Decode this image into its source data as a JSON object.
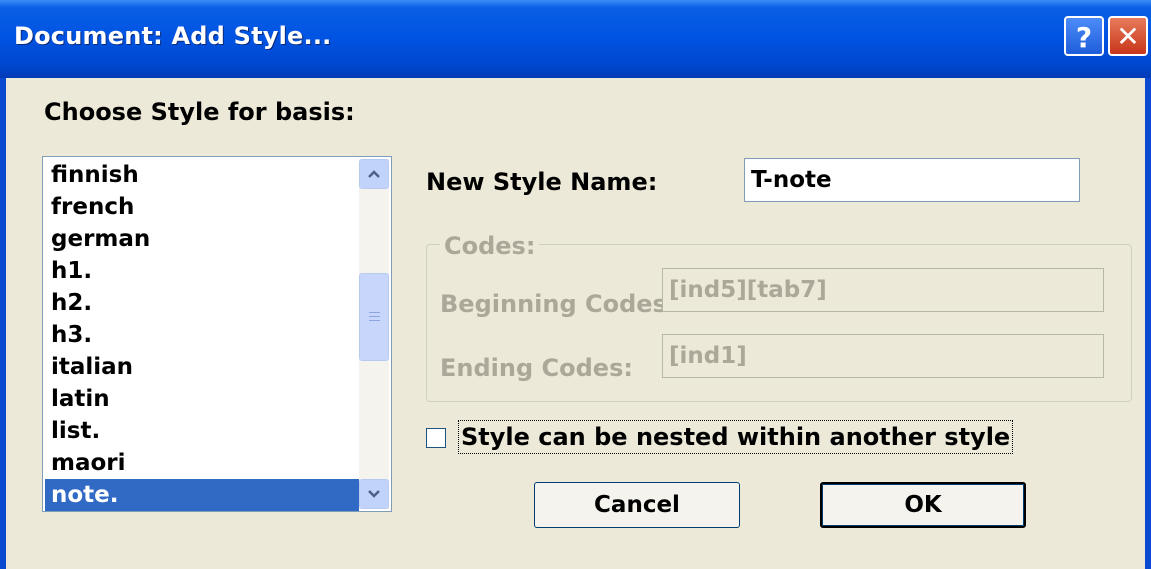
{
  "window": {
    "title": "Document: Add Style...",
    "help_label": "?",
    "close_label": "✕"
  },
  "basis": {
    "label": "Choose Style for basis:",
    "items": [
      "finnish",
      "french",
      "german",
      "h1.",
      "h2.",
      "h3.",
      "italian",
      "latin",
      "list.",
      "maori",
      "note."
    ],
    "selected": "note."
  },
  "name": {
    "label": "New Style Name:",
    "value": "T-note"
  },
  "codes": {
    "legend": "Codes:",
    "beginning_label": "Beginning Codes:",
    "beginning_value": "[ind5][tab7]",
    "ending_label": "Ending Codes:",
    "ending_value": "[ind1]"
  },
  "nested": {
    "label": "Style can be nested within another style",
    "checked": false
  },
  "buttons": {
    "cancel": "Cancel",
    "ok": "OK"
  },
  "icons": {
    "scroll_up": "chevron-up-icon",
    "scroll_down": "chevron-down-icon"
  }
}
